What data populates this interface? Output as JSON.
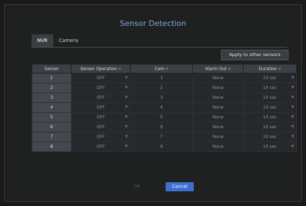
{
  "dialog": {
    "title": "Sensor Detection"
  },
  "tabs": [
    {
      "label": "NVR"
    },
    {
      "label": "Camera"
    }
  ],
  "apply_label": "Apply to other sensors",
  "table": {
    "headers": [
      "Sensor",
      "Sensor Operation",
      "Cam",
      "Alarm Out",
      "Duration"
    ],
    "rows": [
      {
        "sensor": "1",
        "operation": "OFF",
        "cam": "1",
        "alarm": "None",
        "duration": "10 sec"
      },
      {
        "sensor": "2",
        "operation": "OFF",
        "cam": "2",
        "alarm": "None",
        "duration": "10 sec"
      },
      {
        "sensor": "3",
        "operation": "OFF",
        "cam": "3",
        "alarm": "None",
        "duration": "10 sec"
      },
      {
        "sensor": "4",
        "operation": "OFF",
        "cam": "4",
        "alarm": "None",
        "duration": "10 sec"
      },
      {
        "sensor": "5",
        "operation": "OFF",
        "cam": "5",
        "alarm": "None",
        "duration": "10 sec"
      },
      {
        "sensor": "6",
        "operation": "OFF",
        "cam": "6",
        "alarm": "None",
        "duration": "10 sec"
      },
      {
        "sensor": "7",
        "operation": "OFF",
        "cam": "7",
        "alarm": "None",
        "duration": "10 sec"
      },
      {
        "sensor": "8",
        "operation": "OFF",
        "cam": "8",
        "alarm": "None",
        "duration": "10 sec"
      }
    ]
  },
  "footer": {
    "ok_label": "OK",
    "cancel_label": "Cancel"
  },
  "colors": {
    "title": "#7fa6d8",
    "primary_button": "#3c6fd1"
  }
}
